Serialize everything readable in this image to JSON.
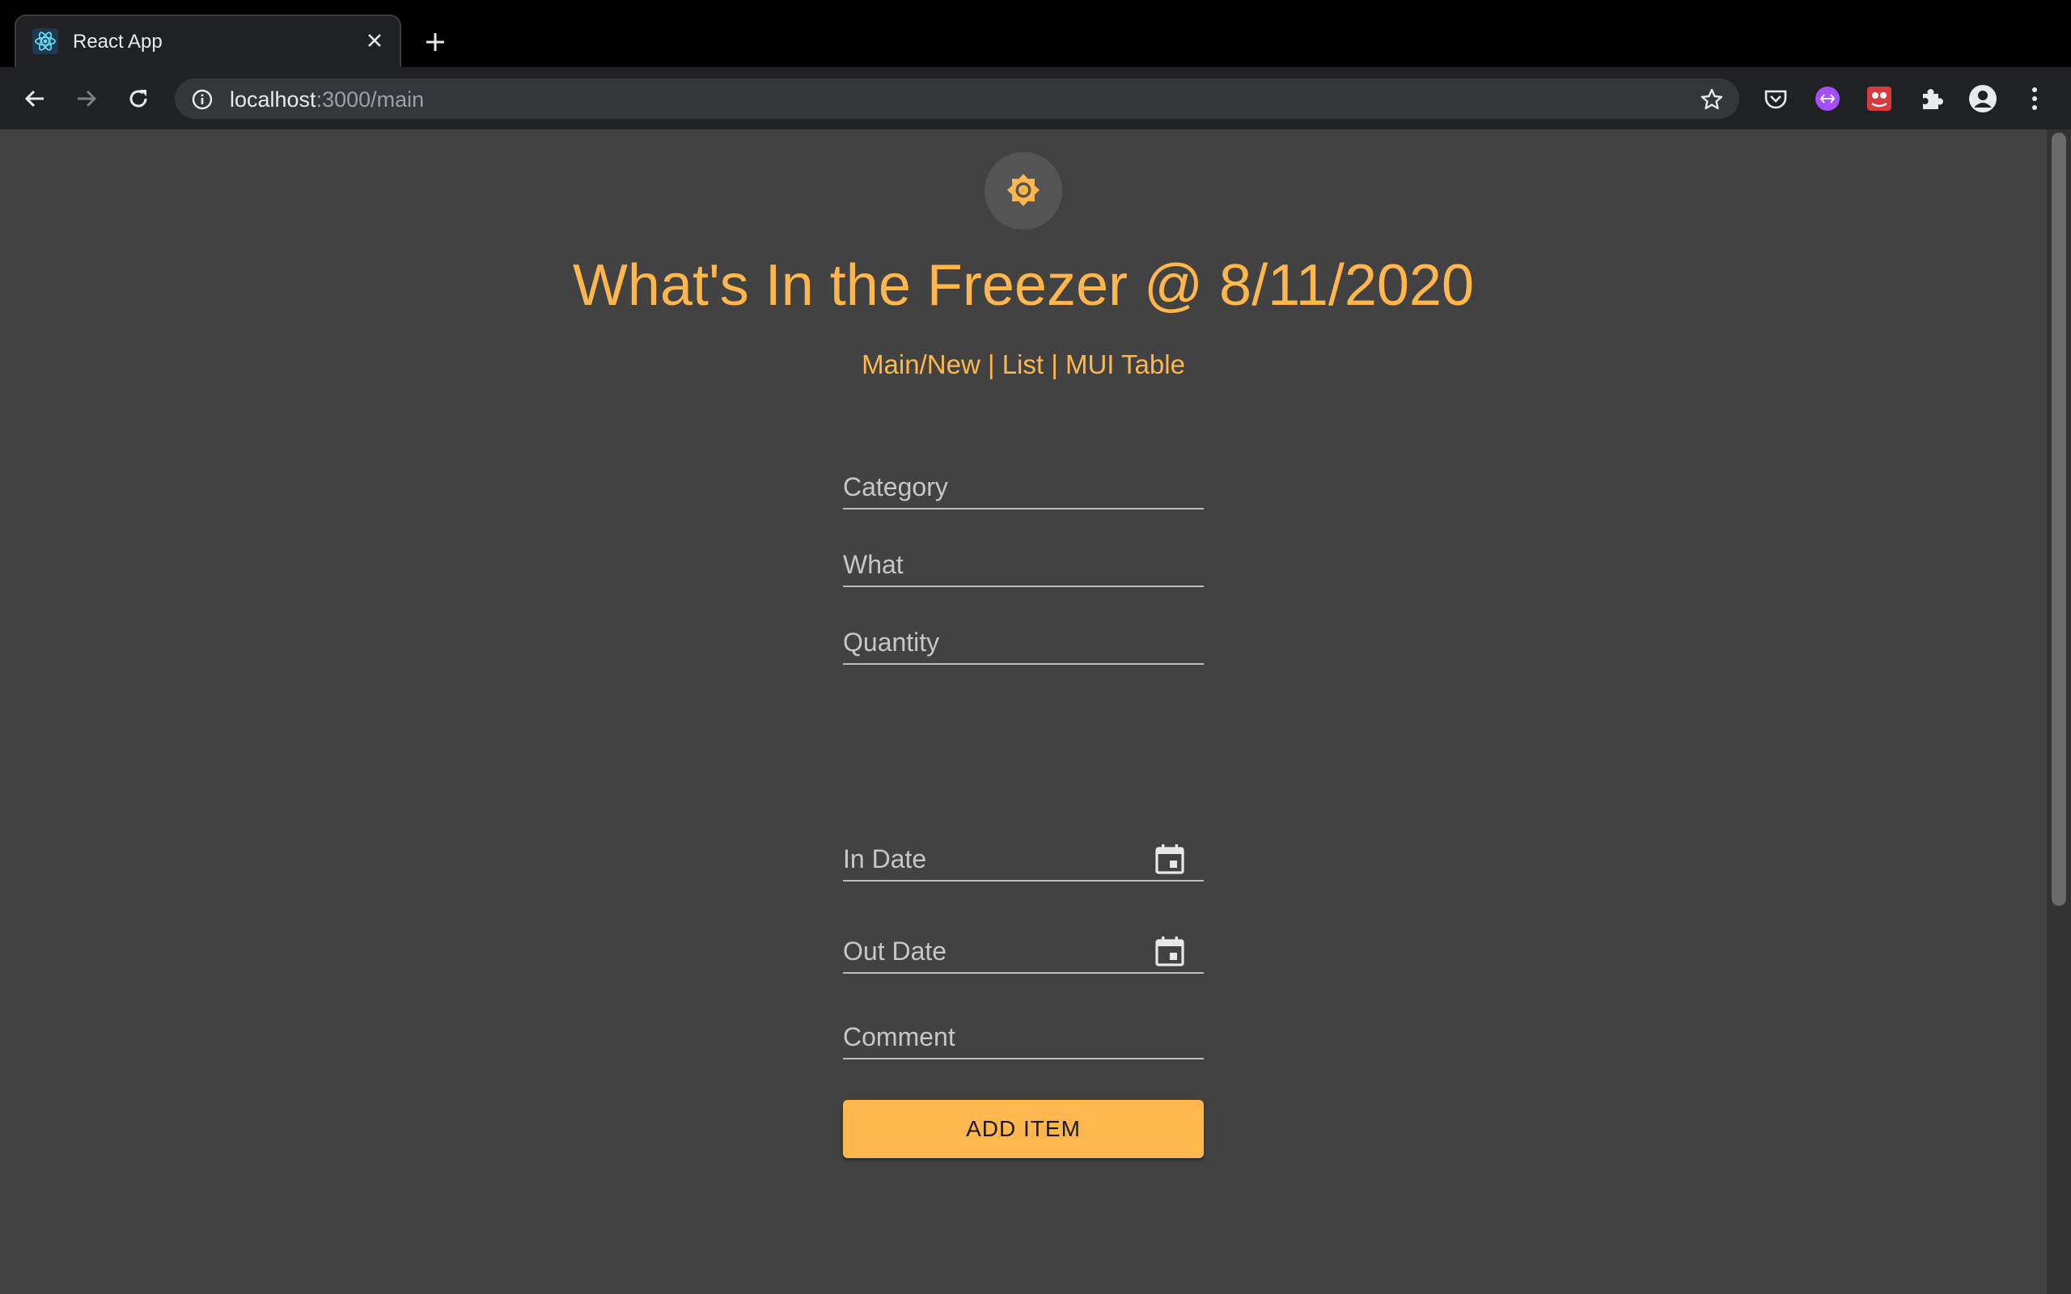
{
  "browser": {
    "tab": {
      "title": "React App",
      "favicon": "react-atom-icon"
    },
    "url": {
      "host": "localhost",
      "rest": ":3000/main"
    },
    "icons": [
      "back-icon",
      "forward-icon",
      "reload-icon",
      "info-icon",
      "bookmark-star-icon",
      "pocket-icon",
      "extension-purple-icon",
      "extension-red-icon",
      "puzzle-extensions-icon",
      "profile-icon",
      "menu-dots-icon"
    ]
  },
  "page": {
    "theme_icon": "sun-icon",
    "title": "What's In the Freezer @ 8/11/2020",
    "nav": {
      "link1": "Main/New",
      "sep1": " | ",
      "link2": "List",
      "sep2": " | ",
      "link3": "MUI Table"
    },
    "form": {
      "category_placeholder": "Category",
      "what_placeholder": "What",
      "quantity_placeholder": "Quantity",
      "in_date_placeholder": "In Date",
      "out_date_placeholder": "Out Date",
      "comment_placeholder": "Comment",
      "submit_label": "ADD ITEM"
    }
  },
  "colors": {
    "accent": "#ffb74d",
    "background": "#424242",
    "chrome": "#202124"
  }
}
